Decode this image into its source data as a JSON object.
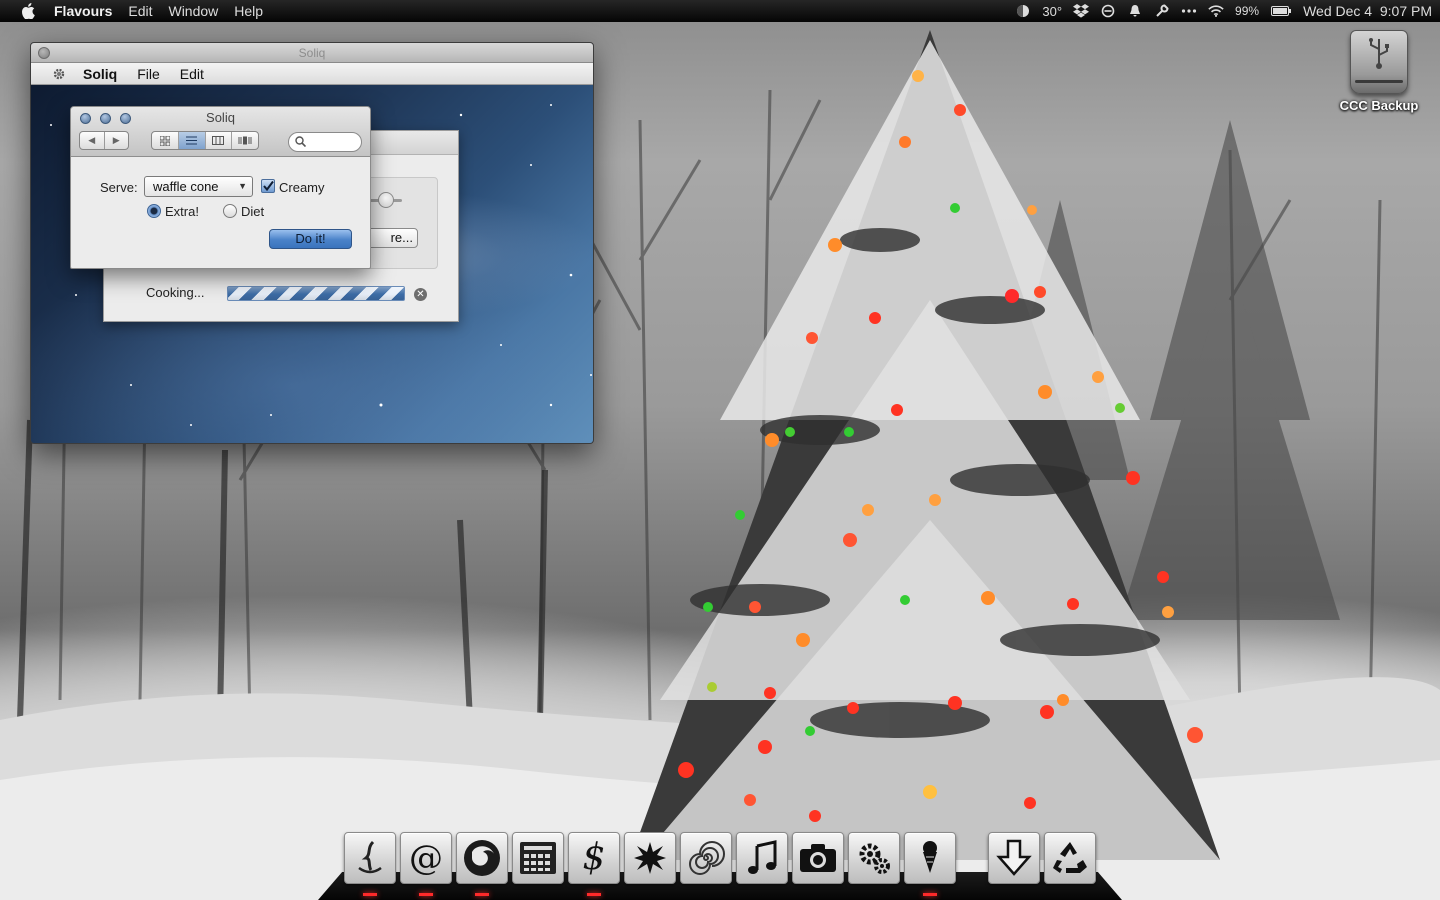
{
  "menubar": {
    "app_name": "Flavours",
    "items": [
      "Edit",
      "Window",
      "Help"
    ],
    "status": {
      "temperature": "30°",
      "battery": "99%",
      "datetime": "Wed Dec 4  9:07 PM"
    },
    "icons": [
      "apple-icon",
      "weather-moon-icon",
      "dropbox-icon",
      "do-not-disturb-icon",
      "notification-bell-icon",
      "wrench-icon",
      "more-dots-icon",
      "wifi-icon",
      "battery-icon"
    ]
  },
  "desktop": {
    "drive_label": "CCC Backup"
  },
  "main_window": {
    "title": "Soliq",
    "menu": {
      "app": "Soliq",
      "file": "File",
      "edit": "Edit"
    }
  },
  "back_panel": {
    "button_partial": "re...",
    "progress_label": "Cooking...",
    "progress_indeterminate": true
  },
  "dialog": {
    "title": "Soliq",
    "search_placeholder": "",
    "serve_label": "Serve:",
    "serve_value": "waffle cone",
    "creamy_label": "Creamy",
    "creamy_checked": true,
    "radios": [
      {
        "label": "Extra!",
        "selected": true
      },
      {
        "label": "Diet",
        "selected": false
      }
    ],
    "action_button": "Do it!"
  },
  "dock": {
    "items": [
      {
        "name": "finder",
        "glyph": "⚡",
        "running": true
      },
      {
        "name": "mail",
        "glyph": "@",
        "running": true
      },
      {
        "name": "firefox",
        "glyph": "◉",
        "running": true
      },
      {
        "name": "calculator",
        "glyph": "▦",
        "running": false
      },
      {
        "name": "money",
        "glyph": "$",
        "running": true
      },
      {
        "name": "starburst",
        "glyph": "✸",
        "running": false
      },
      {
        "name": "spiral",
        "glyph": "@",
        "running": false
      },
      {
        "name": "itunes",
        "glyph": "♫",
        "running": false
      },
      {
        "name": "camera",
        "glyph": "📷",
        "running": false
      },
      {
        "name": "system-preferences",
        "glyph": "⚙",
        "running": false
      },
      {
        "name": "ice-cream",
        "glyph": "🍦",
        "running": true
      },
      {
        "name": "downloads",
        "glyph": "⇩",
        "running": false
      },
      {
        "name": "trash",
        "glyph": "♻",
        "running": false
      }
    ]
  },
  "colors": {
    "accent": "#3a74bd",
    "running_indicator": "#ff2a2a"
  }
}
